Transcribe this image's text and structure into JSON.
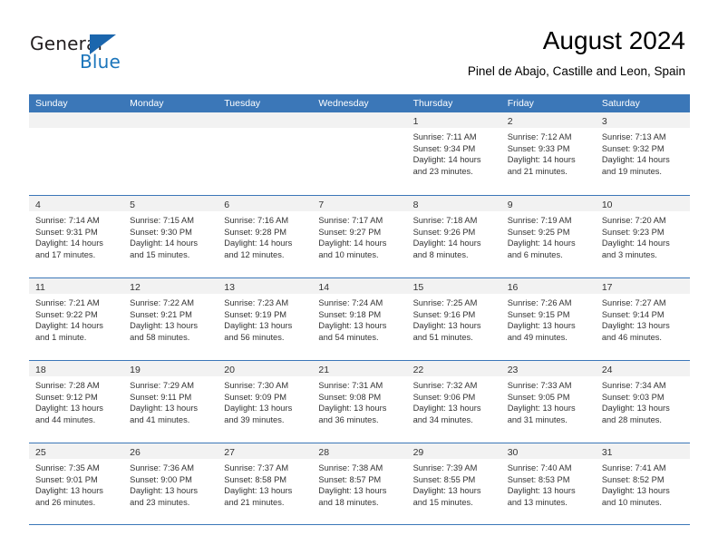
{
  "brand": {
    "name_part1": "General",
    "name_part2": "Blue",
    "accent_color": "#1b75bb",
    "triangle_color": "#1b66ad",
    "logo_icon": "triangle-icon"
  },
  "header": {
    "month_title": "August 2024",
    "location": "Pinel de Abajo, Castille and Leon, Spain"
  },
  "calendar": {
    "header_bg": "#3b77b8",
    "day_strip_bg": "#f2f2f2",
    "weekdays": [
      "Sunday",
      "Monday",
      "Tuesday",
      "Wednesday",
      "Thursday",
      "Friday",
      "Saturday"
    ],
    "weeks": [
      [
        {
          "day": "",
          "sunrise": "",
          "sunset": "",
          "daylight_1": "",
          "daylight_2": ""
        },
        {
          "day": "",
          "sunrise": "",
          "sunset": "",
          "daylight_1": "",
          "daylight_2": ""
        },
        {
          "day": "",
          "sunrise": "",
          "sunset": "",
          "daylight_1": "",
          "daylight_2": ""
        },
        {
          "day": "",
          "sunrise": "",
          "sunset": "",
          "daylight_1": "",
          "daylight_2": ""
        },
        {
          "day": "1",
          "sunrise": "Sunrise: 7:11 AM",
          "sunset": "Sunset: 9:34 PM",
          "daylight_1": "Daylight: 14 hours",
          "daylight_2": "and 23 minutes."
        },
        {
          "day": "2",
          "sunrise": "Sunrise: 7:12 AM",
          "sunset": "Sunset: 9:33 PM",
          "daylight_1": "Daylight: 14 hours",
          "daylight_2": "and 21 minutes."
        },
        {
          "day": "3",
          "sunrise": "Sunrise: 7:13 AM",
          "sunset": "Sunset: 9:32 PM",
          "daylight_1": "Daylight: 14 hours",
          "daylight_2": "and 19 minutes."
        }
      ],
      [
        {
          "day": "4",
          "sunrise": "Sunrise: 7:14 AM",
          "sunset": "Sunset: 9:31 PM",
          "daylight_1": "Daylight: 14 hours",
          "daylight_2": "and 17 minutes."
        },
        {
          "day": "5",
          "sunrise": "Sunrise: 7:15 AM",
          "sunset": "Sunset: 9:30 PM",
          "daylight_1": "Daylight: 14 hours",
          "daylight_2": "and 15 minutes."
        },
        {
          "day": "6",
          "sunrise": "Sunrise: 7:16 AM",
          "sunset": "Sunset: 9:28 PM",
          "daylight_1": "Daylight: 14 hours",
          "daylight_2": "and 12 minutes."
        },
        {
          "day": "7",
          "sunrise": "Sunrise: 7:17 AM",
          "sunset": "Sunset: 9:27 PM",
          "daylight_1": "Daylight: 14 hours",
          "daylight_2": "and 10 minutes."
        },
        {
          "day": "8",
          "sunrise": "Sunrise: 7:18 AM",
          "sunset": "Sunset: 9:26 PM",
          "daylight_1": "Daylight: 14 hours",
          "daylight_2": "and 8 minutes."
        },
        {
          "day": "9",
          "sunrise": "Sunrise: 7:19 AM",
          "sunset": "Sunset: 9:25 PM",
          "daylight_1": "Daylight: 14 hours",
          "daylight_2": "and 6 minutes."
        },
        {
          "day": "10",
          "sunrise": "Sunrise: 7:20 AM",
          "sunset": "Sunset: 9:23 PM",
          "daylight_1": "Daylight: 14 hours",
          "daylight_2": "and 3 minutes."
        }
      ],
      [
        {
          "day": "11",
          "sunrise": "Sunrise: 7:21 AM",
          "sunset": "Sunset: 9:22 PM",
          "daylight_1": "Daylight: 14 hours",
          "daylight_2": "and 1 minute."
        },
        {
          "day": "12",
          "sunrise": "Sunrise: 7:22 AM",
          "sunset": "Sunset: 9:21 PM",
          "daylight_1": "Daylight: 13 hours",
          "daylight_2": "and 58 minutes."
        },
        {
          "day": "13",
          "sunrise": "Sunrise: 7:23 AM",
          "sunset": "Sunset: 9:19 PM",
          "daylight_1": "Daylight: 13 hours",
          "daylight_2": "and 56 minutes."
        },
        {
          "day": "14",
          "sunrise": "Sunrise: 7:24 AM",
          "sunset": "Sunset: 9:18 PM",
          "daylight_1": "Daylight: 13 hours",
          "daylight_2": "and 54 minutes."
        },
        {
          "day": "15",
          "sunrise": "Sunrise: 7:25 AM",
          "sunset": "Sunset: 9:16 PM",
          "daylight_1": "Daylight: 13 hours",
          "daylight_2": "and 51 minutes."
        },
        {
          "day": "16",
          "sunrise": "Sunrise: 7:26 AM",
          "sunset": "Sunset: 9:15 PM",
          "daylight_1": "Daylight: 13 hours",
          "daylight_2": "and 49 minutes."
        },
        {
          "day": "17",
          "sunrise": "Sunrise: 7:27 AM",
          "sunset": "Sunset: 9:14 PM",
          "daylight_1": "Daylight: 13 hours",
          "daylight_2": "and 46 minutes."
        }
      ],
      [
        {
          "day": "18",
          "sunrise": "Sunrise: 7:28 AM",
          "sunset": "Sunset: 9:12 PM",
          "daylight_1": "Daylight: 13 hours",
          "daylight_2": "and 44 minutes."
        },
        {
          "day": "19",
          "sunrise": "Sunrise: 7:29 AM",
          "sunset": "Sunset: 9:11 PM",
          "daylight_1": "Daylight: 13 hours",
          "daylight_2": "and 41 minutes."
        },
        {
          "day": "20",
          "sunrise": "Sunrise: 7:30 AM",
          "sunset": "Sunset: 9:09 PM",
          "daylight_1": "Daylight: 13 hours",
          "daylight_2": "and 39 minutes."
        },
        {
          "day": "21",
          "sunrise": "Sunrise: 7:31 AM",
          "sunset": "Sunset: 9:08 PM",
          "daylight_1": "Daylight: 13 hours",
          "daylight_2": "and 36 minutes."
        },
        {
          "day": "22",
          "sunrise": "Sunrise: 7:32 AM",
          "sunset": "Sunset: 9:06 PM",
          "daylight_1": "Daylight: 13 hours",
          "daylight_2": "and 34 minutes."
        },
        {
          "day": "23",
          "sunrise": "Sunrise: 7:33 AM",
          "sunset": "Sunset: 9:05 PM",
          "daylight_1": "Daylight: 13 hours",
          "daylight_2": "and 31 minutes."
        },
        {
          "day": "24",
          "sunrise": "Sunrise: 7:34 AM",
          "sunset": "Sunset: 9:03 PM",
          "daylight_1": "Daylight: 13 hours",
          "daylight_2": "and 28 minutes."
        }
      ],
      [
        {
          "day": "25",
          "sunrise": "Sunrise: 7:35 AM",
          "sunset": "Sunset: 9:01 PM",
          "daylight_1": "Daylight: 13 hours",
          "daylight_2": "and 26 minutes."
        },
        {
          "day": "26",
          "sunrise": "Sunrise: 7:36 AM",
          "sunset": "Sunset: 9:00 PM",
          "daylight_1": "Daylight: 13 hours",
          "daylight_2": "and 23 minutes."
        },
        {
          "day": "27",
          "sunrise": "Sunrise: 7:37 AM",
          "sunset": "Sunset: 8:58 PM",
          "daylight_1": "Daylight: 13 hours",
          "daylight_2": "and 21 minutes."
        },
        {
          "day": "28",
          "sunrise": "Sunrise: 7:38 AM",
          "sunset": "Sunset: 8:57 PM",
          "daylight_1": "Daylight: 13 hours",
          "daylight_2": "and 18 minutes."
        },
        {
          "day": "29",
          "sunrise": "Sunrise: 7:39 AM",
          "sunset": "Sunset: 8:55 PM",
          "daylight_1": "Daylight: 13 hours",
          "daylight_2": "and 15 minutes."
        },
        {
          "day": "30",
          "sunrise": "Sunrise: 7:40 AM",
          "sunset": "Sunset: 8:53 PM",
          "daylight_1": "Daylight: 13 hours",
          "daylight_2": "and 13 minutes."
        },
        {
          "day": "31",
          "sunrise": "Sunrise: 7:41 AM",
          "sunset": "Sunset: 8:52 PM",
          "daylight_1": "Daylight: 13 hours",
          "daylight_2": "and 10 minutes."
        }
      ]
    ]
  }
}
